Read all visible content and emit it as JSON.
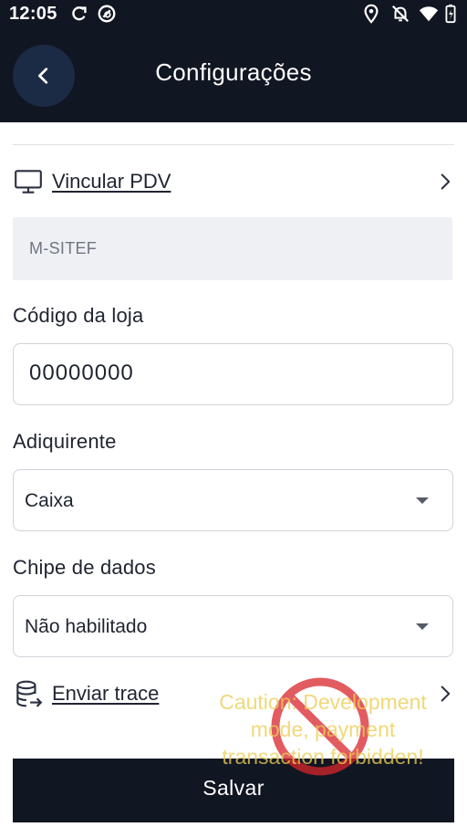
{
  "status_bar": {
    "time": "12:05",
    "icons": [
      "sync-icon",
      "no-signal-circle-icon",
      "location-icon",
      "bell-off-icon",
      "wifi-icon",
      "battery-icon"
    ]
  },
  "app_bar": {
    "title": "Configurações",
    "back_icon": "chevron-left-icon"
  },
  "vincular_pdv": {
    "label": "Vincular PDV",
    "icon": "monitor-icon",
    "value": "M-SITEF"
  },
  "codigo_loja": {
    "label": "Código da loja",
    "value": "00000000"
  },
  "adiquirente": {
    "label": "Adiquirente",
    "selected": "Caixa"
  },
  "chipe_dados": {
    "label": "Chipe de dados",
    "selected": "Não habilitado"
  },
  "enviar_trace": {
    "label": "Enviar trace",
    "icon": "database-send-icon"
  },
  "save_button": {
    "label": "Salvar"
  },
  "dev_watermark": {
    "text": "Caution: Development mode, payment transaction forbidden!",
    "color": "#ECCD55",
    "sign_color": "#D9252B"
  },
  "colors": {
    "header_bg": "#101622",
    "back_button_bg": "#1C2B45",
    "field_bg": "#EEF0F3"
  }
}
